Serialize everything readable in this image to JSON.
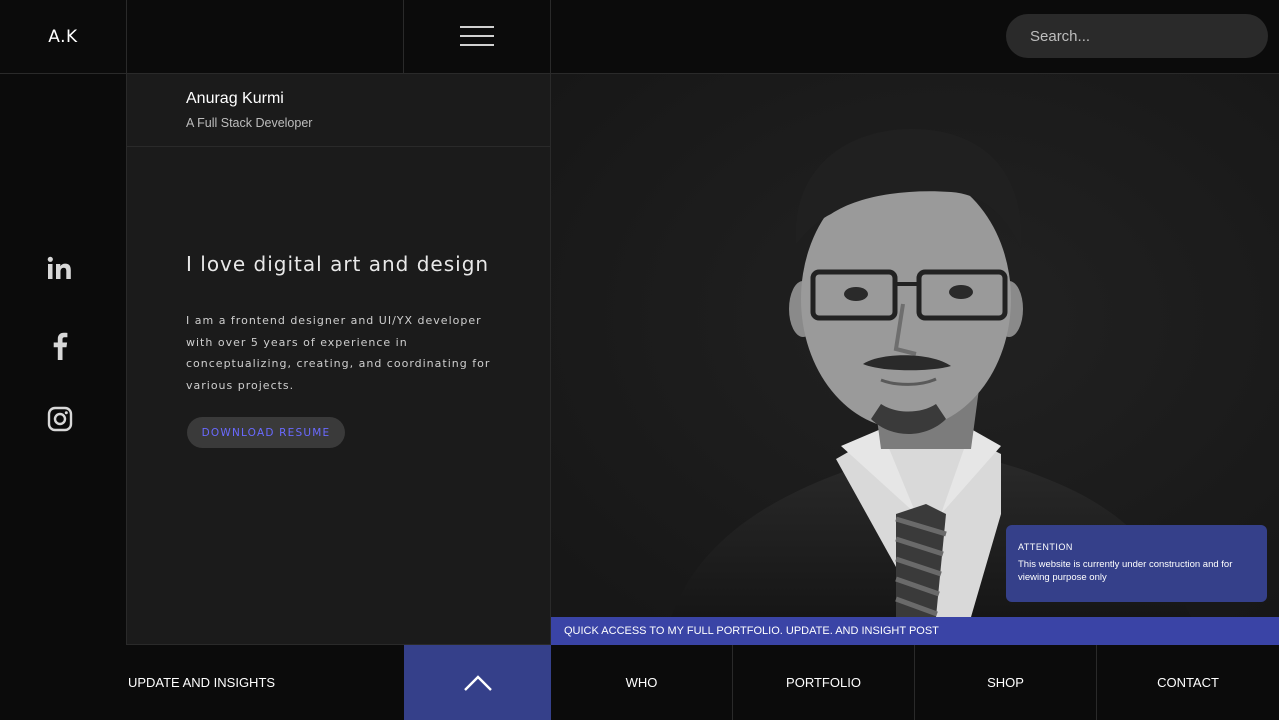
{
  "brand": {
    "logo": "A.K"
  },
  "search": {
    "placeholder": "Search..."
  },
  "profile": {
    "name": "Anurag Kurmi",
    "role": "A Full Stack Developer"
  },
  "intro": {
    "headline": "I love digital art and design",
    "bio": "I am a frontend designer and UI/YX developer with over 5 years of experience in conceptualizing, creating, and coordinating for various projects.",
    "button_label": "DOWNLOAD RESUME"
  },
  "social": [
    {
      "icon": "linkedin-icon"
    },
    {
      "icon": "facebook-icon"
    },
    {
      "icon": "instagram-icon"
    }
  ],
  "attention": {
    "title": "ATTENTION",
    "text": "This website is currently under construction and for viewing purpose only"
  },
  "ticker": {
    "text": "QUICK ACCESS TO MY FULL PORTFOLIO. UPDATE. AND INSIGHT POST"
  },
  "bottom_nav": {
    "left_label": "UPDATE AND INSIGHTS",
    "items": [
      "WHO",
      "PORTFOLIO",
      "SHOP",
      "CONTACT"
    ]
  },
  "colors": {
    "accent": "#35408a",
    "ticker": "#3a44a6",
    "panel": "#1b1b1b",
    "background": "#0b0b0b",
    "button_text": "#6a6aff"
  }
}
